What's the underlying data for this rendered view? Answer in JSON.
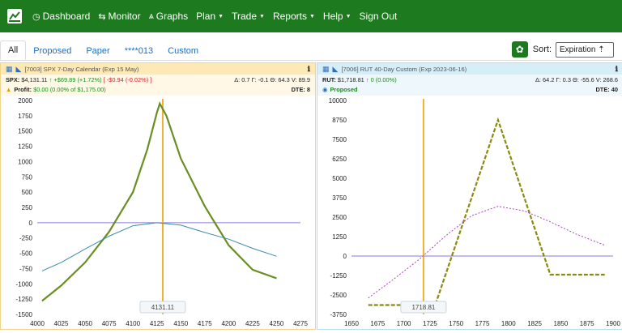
{
  "navbar": {
    "items": [
      {
        "icon": "dashboard-icon",
        "glyph": "◷",
        "label": "Dashboard",
        "caret": false
      },
      {
        "icon": "monitor-icon",
        "glyph": "⇆",
        "label": "Monitor",
        "caret": false
      },
      {
        "icon": "graphs-icon",
        "glyph": "⩓",
        "label": "Graphs",
        "caret": false
      },
      {
        "icon": "",
        "glyph": "",
        "label": "Plan",
        "caret": true
      },
      {
        "icon": "",
        "glyph": "",
        "label": "Trade",
        "caret": true
      },
      {
        "icon": "",
        "glyph": "",
        "label": "Reports",
        "caret": true
      },
      {
        "icon": "",
        "glyph": "",
        "label": "Help",
        "caret": true
      },
      {
        "icon": "",
        "glyph": "",
        "label": "Sign Out",
        "caret": false
      }
    ]
  },
  "tabs": [
    "All",
    "Proposed",
    "Paper",
    "****013",
    "Custom"
  ],
  "active_tab": "All",
  "sort": {
    "label": "Sort:",
    "value": "Expiration ⇡"
  },
  "panels": [
    {
      "title": "[7003] SPX 7-Day Calendar (Exp 15 May)",
      "quote_sym": "SPX:",
      "quote_price": "$4,131.11",
      "quote_change": "↑ +$69.89 (+1.72%)",
      "quote_change2": "[ -$0.94 (-0.02%) ]",
      "greeks": "Δ: 0.7 Γ: -0.1 Θ: 64.3 V: 89.9",
      "status_label": "Profit:",
      "status_value": "$0.00 (0.00% of $1,175.00)",
      "dte": "DTE: 8",
      "marker_label": "4131.11"
    },
    {
      "title": "[7006] RUT 40-Day Custom (Exp 2023-06-16)",
      "quote_sym": "RUT:",
      "quote_price": "$1,718.81",
      "quote_change": "↑ 0 (0.00%)",
      "quote_change2": "",
      "greeks": "Δ: 64.2 Γ: 0.3 Θ: -55.6 V: 268.6",
      "status_label": "Proposed",
      "status_value": "",
      "dte": "DTE: 40",
      "marker_label": "1718.81"
    }
  ],
  "chart_data": [
    {
      "type": "line",
      "title": "",
      "xlim": [
        4000,
        4275
      ],
      "ylim": [
        -1500,
        2000
      ],
      "xticks": [
        4000,
        4025,
        4050,
        4075,
        4100,
        4125,
        4150,
        4175,
        4200,
        4225,
        4250,
        4275
      ],
      "yticks": [
        2000,
        1750,
        1500,
        1250,
        1000,
        750,
        500,
        250,
        0,
        -250,
        -500,
        -750,
        -1000,
        -1250,
        -1500
      ],
      "current_price": 4131.11,
      "colors": {
        "expiration": "#6b8e23",
        "today": "#3a8ab0",
        "zero": "#8a7ad8",
        "marker": "#f0b030"
      },
      "series": [
        {
          "role": "expiration",
          "x": [
            4005,
            4025,
            4050,
            4075,
            4100,
            4115,
            4125,
            4128,
            4135,
            4150,
            4175,
            4200,
            4225,
            4250
          ],
          "y": [
            -1280,
            -1030,
            -650,
            -150,
            500,
            1200,
            1800,
            1950,
            1750,
            1050,
            270,
            -370,
            -770,
            -910
          ]
        },
        {
          "role": "today",
          "x": [
            4005,
            4025,
            4050,
            4075,
            4100,
            4125,
            4150,
            4175,
            4200,
            4225,
            4250
          ],
          "y": [
            -790,
            -650,
            -430,
            -220,
            -50,
            0,
            -40,
            -160,
            -270,
            -420,
            -550
          ]
        }
      ]
    },
    {
      "type": "line",
      "title": "",
      "xlim": [
        1650,
        1900
      ],
      "ylim": [
        -3750,
        10000
      ],
      "xticks": [
        1650,
        1675,
        1700,
        1725,
        1750,
        1775,
        1800,
        1825,
        1850,
        1875,
        1900
      ],
      "yticks": [
        10000,
        8750,
        7500,
        6250,
        5000,
        3750,
        2500,
        1250,
        0,
        -1250,
        -2500,
        -3750
      ],
      "current_price": 1718.81,
      "colors": {
        "expiration": "#8a8a10",
        "today": "#b040c0",
        "zero": "#8a7ad8",
        "marker": "#f0b030"
      },
      "series": [
        {
          "role": "expiration",
          "x": [
            1666,
            1730,
            1790,
            1840,
            1892
          ],
          "y": [
            -3150,
            -3150,
            8750,
            -1200,
            -1200
          ]
        },
        {
          "role": "today",
          "x": [
            1666,
            1690,
            1715,
            1740,
            1765,
            1790,
            1815,
            1840,
            1865,
            1892
          ],
          "y": [
            -2700,
            -1500,
            -200,
            1300,
            2600,
            3200,
            2900,
            2200,
            1400,
            700
          ]
        }
      ]
    }
  ]
}
